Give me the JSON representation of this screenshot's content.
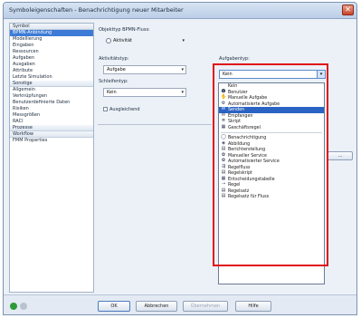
{
  "window": {
    "title": "Symboleigenschaften - Benachrichtigung neuer Mitarbeiter",
    "close_glyph": "✕"
  },
  "nav": {
    "sections": [
      {
        "label": "Symbol",
        "items": [
          "BPMN-Anbindung",
          "Modellierung",
          "Eingaben",
          "Ressourcen",
          "Aufgaben",
          "Ausgaben",
          "Attribute",
          "Letzte Simulation"
        ]
      },
      {
        "label": "Sonstige",
        "items": [
          "Allgemein",
          "Verknüpfungen",
          "Benutzerdefinierte Daten",
          "Risiken",
          "Messgrößen",
          "RACI"
        ]
      },
      {
        "label": "Prozesse",
        "items": []
      },
      {
        "label": "Workflow",
        "items": [
          "FMM Properties"
        ]
      }
    ],
    "selected": "BPMN-Anbindung"
  },
  "form": {
    "bpmn_flow_label": "Objekttyp BPMN-Fluss:",
    "bpmn_flow_value": "Aktivität",
    "activity_type_label": "Aktivitätstyp:",
    "activity_type_value": "Aufgabe",
    "loop_type_label": "Schleifentyp:",
    "loop_type_value": "Kein",
    "compensation_label": "Ausgleichend",
    "task_type_label": "Aufgabentyp:",
    "task_type_value": "Kein",
    "ellipsis_label": "..."
  },
  "dropdown": {
    "items": [
      {
        "label": "Kein",
        "icon": "none-icon",
        "glyph": ""
      },
      {
        "label": "Benutzer",
        "icon": "user-icon",
        "glyph": "☻"
      },
      {
        "label": "Manuelle Aufgabe",
        "icon": "hand-icon",
        "glyph": "✋"
      },
      {
        "label": "Automatisierte Aufgabe",
        "icon": "gear-icon",
        "glyph": "⚙"
      },
      {
        "label": "Senden",
        "icon": "envelope-filled-icon",
        "glyph": "✉"
      },
      {
        "label": "Empfangen",
        "icon": "envelope-icon",
        "glyph": "✉"
      },
      {
        "label": "Skript",
        "icon": "script-icon",
        "glyph": "≣"
      },
      {
        "label": "Geschäftsregel",
        "icon": "table-icon",
        "glyph": "▦"
      }
    ],
    "items2": [
      {
        "label": "Benachrichtigung",
        "icon": "speech-bubble-icon",
        "glyph": "◯"
      },
      {
        "label": "Abbildung",
        "icon": "mapping-icon",
        "glyph": "◈"
      },
      {
        "label": "Berichterstellung",
        "icon": "report-icon",
        "glyph": "▤"
      },
      {
        "label": "Manueller Service",
        "icon": "manual-service-icon",
        "glyph": "✿"
      },
      {
        "label": "Automatisierter Service",
        "icon": "auto-service-icon",
        "glyph": "✿"
      },
      {
        "label": "Regelfluss",
        "icon": "rule-flow-icon",
        "glyph": "⇶"
      },
      {
        "label": "Regelskript",
        "icon": "rule-script-icon",
        "glyph": "▤"
      },
      {
        "label": "Entscheidungstabelle",
        "icon": "decision-table-icon",
        "glyph": "▦"
      },
      {
        "label": "Regel",
        "icon": "rule-icon",
        "glyph": "⇢"
      },
      {
        "label": "Regelsatz",
        "icon": "ruleset-icon",
        "glyph": "▤"
      },
      {
        "label": "Regelsatz für Fluss",
        "icon": "ruleset-flow-icon",
        "glyph": "▤"
      }
    ],
    "selected": "Senden"
  },
  "footer": {
    "ok_label": "OK",
    "cancel_label": "Abbrechen",
    "apply_label": "Übernehmen",
    "help_label": "Hilfe",
    "status_colors": [
      "#2f9a3a",
      "#b9c3cf"
    ]
  }
}
